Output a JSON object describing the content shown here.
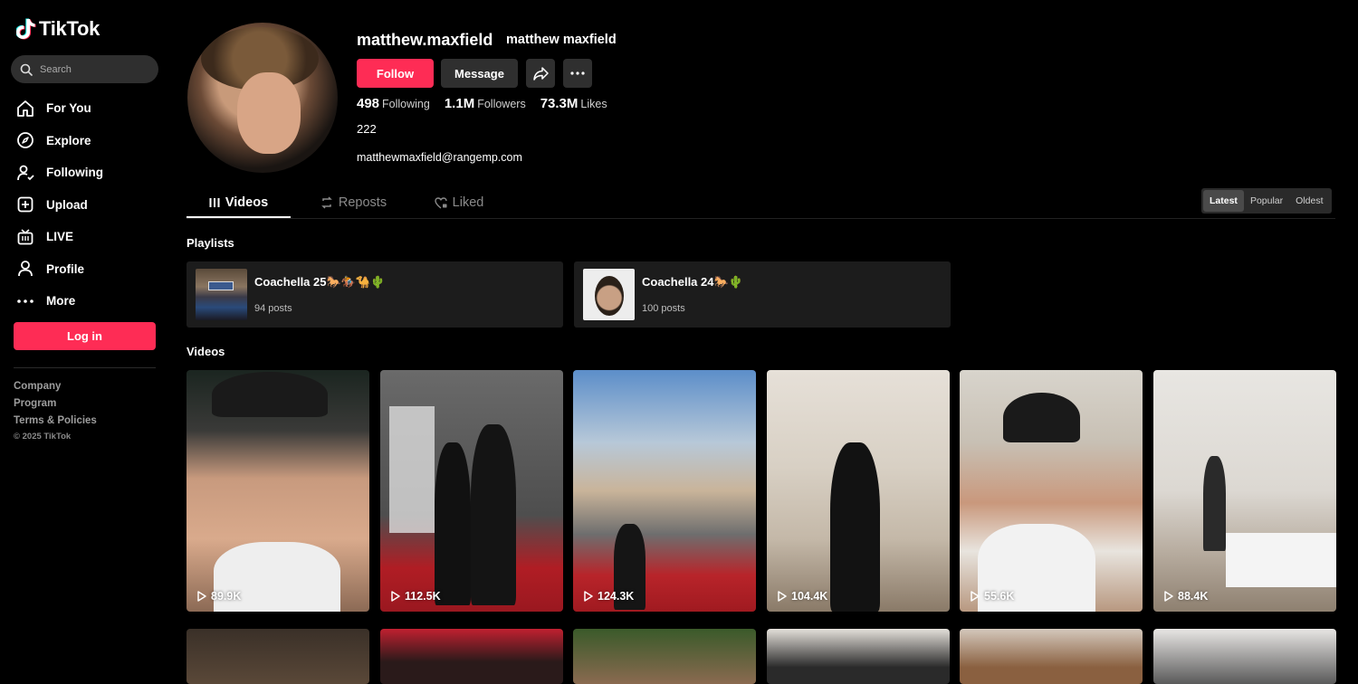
{
  "brand": {
    "name": "TikTok"
  },
  "search": {
    "placeholder": "Search"
  },
  "nav": [
    {
      "label": "For You",
      "icon": "home-icon"
    },
    {
      "label": "Explore",
      "icon": "compass-icon"
    },
    {
      "label": "Following",
      "icon": "following-icon"
    },
    {
      "label": "Upload",
      "icon": "upload-icon"
    },
    {
      "label": "LIVE",
      "icon": "live-icon"
    },
    {
      "label": "Profile",
      "icon": "profile-icon"
    },
    {
      "label": "More",
      "icon": "more-icon"
    }
  ],
  "login_label": "Log in",
  "footer": {
    "company": "Company",
    "program": "Program",
    "terms": "Terms & Policies",
    "copyright": "© 2025 TikTok"
  },
  "profile": {
    "username": "matthew.maxfield",
    "nickname": "matthew maxfield",
    "follow_label": "Follow",
    "message_label": "Message",
    "following_count": "498",
    "following_label": "Following",
    "followers_count": "1.1M",
    "followers_label": "Followers",
    "likes_count": "73.3M",
    "likes_label": "Likes",
    "bio": "222",
    "email": "matthewmaxfield@rangemp.com"
  },
  "tabs": {
    "videos": "Videos",
    "reposts": "Reposts",
    "liked": "Liked"
  },
  "sort": {
    "latest": "Latest",
    "popular": "Popular",
    "oldest": "Oldest"
  },
  "sections": {
    "playlists": "Playlists",
    "videos": "Videos"
  },
  "playlists": [
    {
      "title": "Coachella 25🐎🏇🐪🌵",
      "count": "94 posts"
    },
    {
      "title": "Coachella 24🐎🌵",
      "count": "100 posts"
    }
  ],
  "videos": [
    {
      "views": "89.9K"
    },
    {
      "views": "112.5K"
    },
    {
      "views": "124.3K"
    },
    {
      "views": "104.4K"
    },
    {
      "views": "55.6K"
    },
    {
      "views": "88.4K"
    }
  ],
  "colors": {
    "accent": "#fe2c55",
    "background": "#000000"
  }
}
